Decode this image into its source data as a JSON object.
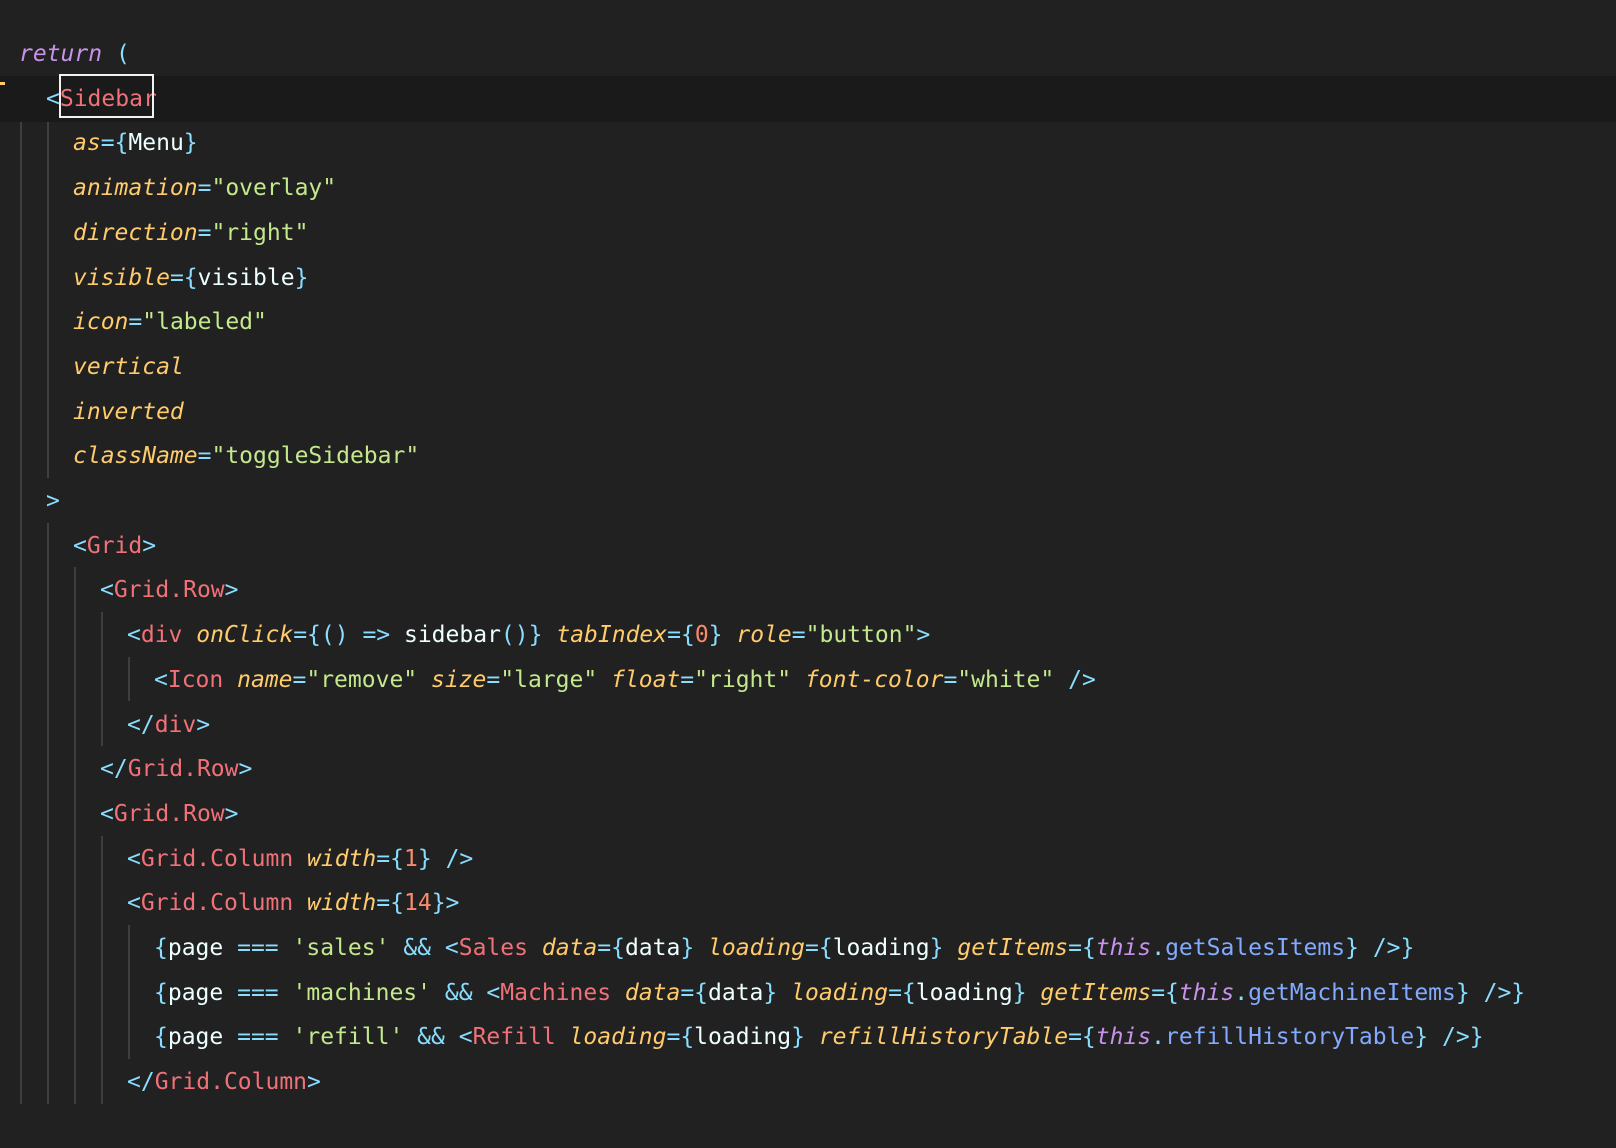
{
  "editor": {
    "colors": {
      "background": "#212121",
      "current_line": "#1a1a1a",
      "keyword": "#c792ea",
      "punctuation": "#89ddff",
      "tag": "#f07178",
      "attribute": "#ffcb6b",
      "string": "#c3e88d",
      "number": "#f78c6c",
      "identifier": "#eeffff",
      "property": "#82aaff"
    },
    "cursor_token": "Sidebar",
    "lines": [
      {
        "indent": 0,
        "tokens": [
          [
            "kw",
            "return"
          ],
          [
            "id",
            " "
          ],
          [
            "pu",
            "("
          ]
        ]
      },
      {
        "indent": 1,
        "current": true,
        "tokens": [
          [
            "pu",
            "<"
          ],
          [
            "tg",
            "Sidebar"
          ]
        ]
      },
      {
        "indent": 2,
        "tokens": [
          [
            "at",
            "as"
          ],
          [
            "pu",
            "={"
          ],
          [
            "id",
            "Menu"
          ],
          [
            "pu",
            "}"
          ]
        ]
      },
      {
        "indent": 2,
        "tokens": [
          [
            "at",
            "animation"
          ],
          [
            "pu",
            "="
          ],
          [
            "st",
            "\"overlay\""
          ]
        ]
      },
      {
        "indent": 2,
        "tokens": [
          [
            "at",
            "direction"
          ],
          [
            "pu",
            "="
          ],
          [
            "st",
            "\"right\""
          ]
        ]
      },
      {
        "indent": 2,
        "tokens": [
          [
            "at",
            "visible"
          ],
          [
            "pu",
            "={"
          ],
          [
            "id",
            "visible"
          ],
          [
            "pu",
            "}"
          ]
        ]
      },
      {
        "indent": 2,
        "tokens": [
          [
            "at",
            "icon"
          ],
          [
            "pu",
            "="
          ],
          [
            "st",
            "\"labeled\""
          ]
        ]
      },
      {
        "indent": 2,
        "tokens": [
          [
            "at",
            "vertical"
          ]
        ]
      },
      {
        "indent": 2,
        "tokens": [
          [
            "at",
            "inverted"
          ]
        ]
      },
      {
        "indent": 2,
        "tokens": [
          [
            "at",
            "className"
          ],
          [
            "pu",
            "="
          ],
          [
            "st",
            "\"toggleSidebar\""
          ]
        ]
      },
      {
        "indent": 1,
        "tokens": [
          [
            "pu",
            ">"
          ]
        ]
      },
      {
        "indent": 2,
        "tokens": [
          [
            "pu",
            "<"
          ],
          [
            "tg",
            "Grid"
          ],
          [
            "pu",
            ">"
          ]
        ]
      },
      {
        "indent": 3,
        "tokens": [
          [
            "pu",
            "<"
          ],
          [
            "tg",
            "Grid.Row"
          ],
          [
            "pu",
            ">"
          ]
        ]
      },
      {
        "indent": 4,
        "tokens": [
          [
            "pu",
            "<"
          ],
          [
            "tg",
            "div"
          ],
          [
            "id",
            " "
          ],
          [
            "at",
            "onClick"
          ],
          [
            "pu",
            "={() =>"
          ],
          [
            "id",
            " sidebar"
          ],
          [
            "pu",
            "()}"
          ],
          [
            "id",
            " "
          ],
          [
            "at",
            "tabIndex"
          ],
          [
            "pu",
            "={"
          ],
          [
            "nu",
            "0"
          ],
          [
            "pu",
            "}"
          ],
          [
            "id",
            " "
          ],
          [
            "at",
            "role"
          ],
          [
            "pu",
            "="
          ],
          [
            "st",
            "\"button\""
          ],
          [
            "pu",
            ">"
          ]
        ]
      },
      {
        "indent": 5,
        "tokens": [
          [
            "pu",
            "<"
          ],
          [
            "tg",
            "Icon"
          ],
          [
            "id",
            " "
          ],
          [
            "at",
            "name"
          ],
          [
            "pu",
            "="
          ],
          [
            "st",
            "\"remove\""
          ],
          [
            "id",
            " "
          ],
          [
            "at",
            "size"
          ],
          [
            "pu",
            "="
          ],
          [
            "st",
            "\"large\""
          ],
          [
            "id",
            " "
          ],
          [
            "at",
            "float"
          ],
          [
            "pu",
            "="
          ],
          [
            "st",
            "\"right\""
          ],
          [
            "id",
            " "
          ],
          [
            "at",
            "font-color"
          ],
          [
            "pu",
            "="
          ],
          [
            "st",
            "\"white\""
          ],
          [
            "id",
            " "
          ],
          [
            "pu",
            "/>"
          ]
        ]
      },
      {
        "indent": 4,
        "tokens": [
          [
            "pu",
            "</"
          ],
          [
            "tg",
            "div"
          ],
          [
            "pu",
            ">"
          ]
        ]
      },
      {
        "indent": 3,
        "tokens": [
          [
            "pu",
            "</"
          ],
          [
            "tg",
            "Grid.Row"
          ],
          [
            "pu",
            ">"
          ]
        ]
      },
      {
        "indent": 3,
        "tokens": [
          [
            "pu",
            "<"
          ],
          [
            "tg",
            "Grid.Row"
          ],
          [
            "pu",
            ">"
          ]
        ]
      },
      {
        "indent": 4,
        "tokens": [
          [
            "pu",
            "<"
          ],
          [
            "tg",
            "Grid.Column"
          ],
          [
            "id",
            " "
          ],
          [
            "at",
            "width"
          ],
          [
            "pu",
            "={"
          ],
          [
            "nu",
            "1"
          ],
          [
            "pu",
            "}"
          ],
          [
            "id",
            " "
          ],
          [
            "pu",
            "/>"
          ]
        ]
      },
      {
        "indent": 4,
        "tokens": [
          [
            "pu",
            "<"
          ],
          [
            "tg",
            "Grid.Column"
          ],
          [
            "id",
            " "
          ],
          [
            "at",
            "width"
          ],
          [
            "pu",
            "={"
          ],
          [
            "nu",
            "14"
          ],
          [
            "pu",
            "}>"
          ]
        ]
      },
      {
        "indent": 5,
        "tokens": [
          [
            "pu",
            "{"
          ],
          [
            "id",
            "page "
          ],
          [
            "pu",
            "==="
          ],
          [
            "id",
            " "
          ],
          [
            "st",
            "'sales'"
          ],
          [
            "id",
            " "
          ],
          [
            "pu",
            "&&"
          ],
          [
            "id",
            " "
          ],
          [
            "pu",
            "<"
          ],
          [
            "tg",
            "Sales"
          ],
          [
            "id",
            " "
          ],
          [
            "at",
            "data"
          ],
          [
            "pu",
            "={"
          ],
          [
            "id",
            "data"
          ],
          [
            "pu",
            "}"
          ],
          [
            "id",
            " "
          ],
          [
            "at",
            "loading"
          ],
          [
            "pu",
            "={"
          ],
          [
            "id",
            "loading"
          ],
          [
            "pu",
            "}"
          ],
          [
            "id",
            " "
          ],
          [
            "at",
            "getItems"
          ],
          [
            "pu",
            "={"
          ],
          [
            "kw",
            "this"
          ],
          [
            "pu",
            "."
          ],
          [
            "fn",
            "getSalesItems"
          ],
          [
            "pu",
            "}"
          ],
          [
            "id",
            " "
          ],
          [
            "pu",
            "/>}"
          ]
        ]
      },
      {
        "indent": 5,
        "tokens": [
          [
            "pu",
            "{"
          ],
          [
            "id",
            "page "
          ],
          [
            "pu",
            "==="
          ],
          [
            "id",
            " "
          ],
          [
            "st",
            "'machines'"
          ],
          [
            "id",
            " "
          ],
          [
            "pu",
            "&&"
          ],
          [
            "id",
            " "
          ],
          [
            "pu",
            "<"
          ],
          [
            "tg",
            "Machines"
          ],
          [
            "id",
            " "
          ],
          [
            "at",
            "data"
          ],
          [
            "pu",
            "={"
          ],
          [
            "id",
            "data"
          ],
          [
            "pu",
            "}"
          ],
          [
            "id",
            " "
          ],
          [
            "at",
            "loading"
          ],
          [
            "pu",
            "={"
          ],
          [
            "id",
            "loading"
          ],
          [
            "pu",
            "}"
          ],
          [
            "id",
            " "
          ],
          [
            "at",
            "getItems"
          ],
          [
            "pu",
            "={"
          ],
          [
            "kw",
            "this"
          ],
          [
            "pu",
            "."
          ],
          [
            "fn",
            "getMachineItems"
          ],
          [
            "pu",
            "}"
          ],
          [
            "id",
            " "
          ],
          [
            "pu",
            "/>}"
          ]
        ]
      },
      {
        "indent": 5,
        "tokens": [
          [
            "pu",
            "{"
          ],
          [
            "id",
            "page "
          ],
          [
            "pu",
            "==="
          ],
          [
            "id",
            " "
          ],
          [
            "st",
            "'refill'"
          ],
          [
            "id",
            " "
          ],
          [
            "pu",
            "&&"
          ],
          [
            "id",
            " "
          ],
          [
            "pu",
            "<"
          ],
          [
            "tg",
            "Refill"
          ],
          [
            "id",
            " "
          ],
          [
            "at",
            "loading"
          ],
          [
            "pu",
            "={"
          ],
          [
            "id",
            "loading"
          ],
          [
            "pu",
            "}"
          ],
          [
            "id",
            " "
          ],
          [
            "at",
            "refillHistoryTable"
          ],
          [
            "pu",
            "={"
          ],
          [
            "kw",
            "this"
          ],
          [
            "pu",
            "."
          ],
          [
            "fn",
            "refillHistoryTable"
          ],
          [
            "pu",
            "}"
          ],
          [
            "id",
            " "
          ],
          [
            "pu",
            "/>}"
          ]
        ]
      },
      {
        "indent": 4,
        "tokens": [
          [
            "pu",
            "</"
          ],
          [
            "tg",
            "Grid.Column"
          ],
          [
            "pu",
            ">"
          ]
        ]
      }
    ]
  }
}
